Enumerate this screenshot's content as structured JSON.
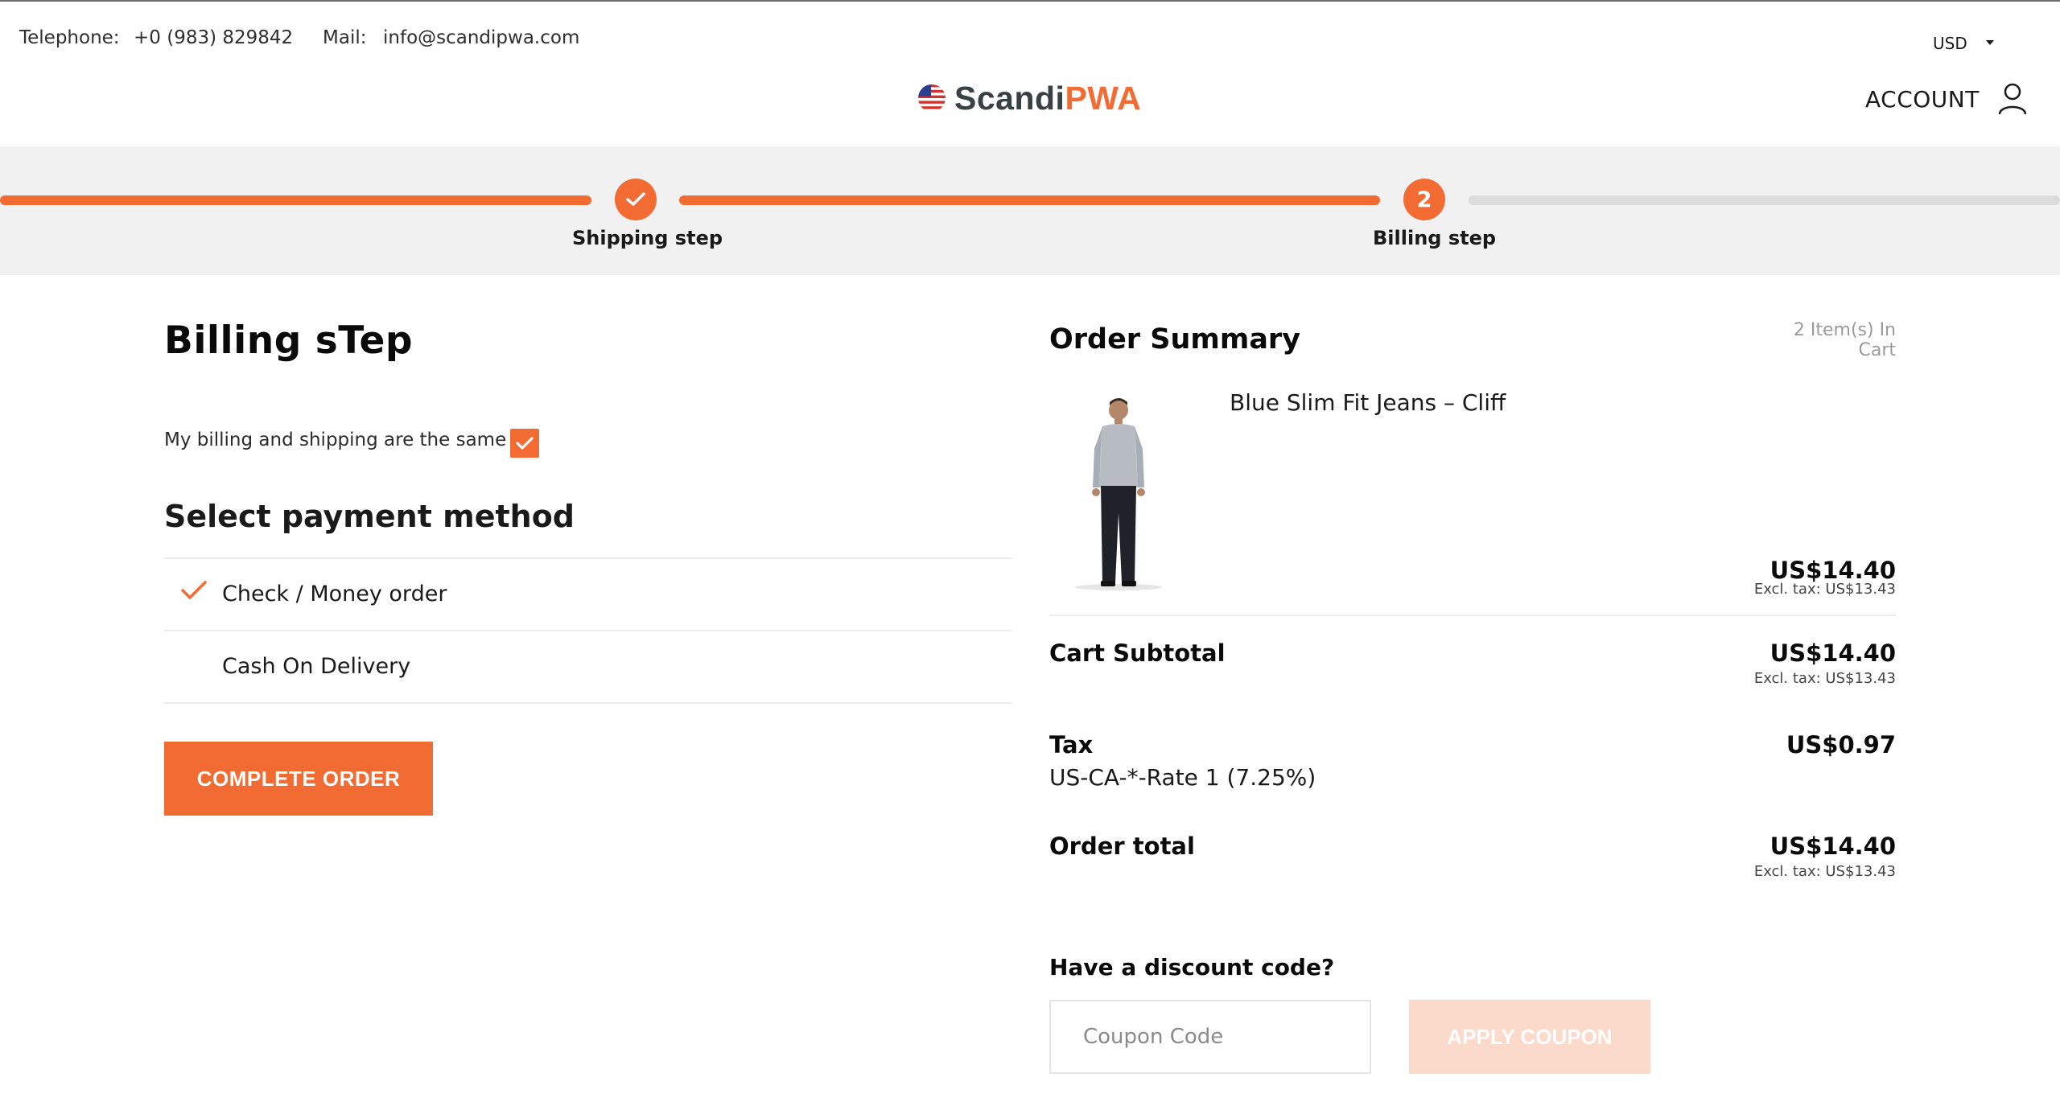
{
  "header": {
    "telephone_label": "Telephone:",
    "telephone_value": "+0 (983) 829842",
    "mail_label": "Mail:",
    "mail_value": "info@scandipwa.com",
    "currency": "USD",
    "logo_text_dark": "Scandi",
    "logo_text_accent": "PWA",
    "account_label": "ACCOUNT"
  },
  "progress": {
    "steps": [
      {
        "label": "Shipping step",
        "state": "done"
      },
      {
        "label": "Billing step",
        "state": "current",
        "number": "2"
      }
    ]
  },
  "billing": {
    "title": "Billing sTep",
    "same_address_label": "My billing and shipping are the same",
    "same_address_checked": true,
    "payment_title": "Select payment method",
    "methods": [
      {
        "label": "Check / Money order",
        "selected": true
      },
      {
        "label": "Cash On Delivery",
        "selected": false
      }
    ],
    "complete_button": "COMPLETE ORDER"
  },
  "summary": {
    "title": "Order Summary",
    "items_count": "2 Item(s) In Cart",
    "product": {
      "name": "Blue Slim Fit Jeans – Cliff",
      "price": "US$14.40",
      "price_excl": "Excl. tax: US$13.43"
    },
    "subtotal_label": "Cart Subtotal",
    "subtotal": "US$14.40",
    "subtotal_excl": "Excl. tax: US$13.43",
    "tax_label": "Tax",
    "tax_rate": "US-CA-*-Rate 1 (7.25%)",
    "tax": "US$0.97",
    "total_label": "Order total",
    "total": "US$14.40",
    "total_excl": "Excl. tax: US$13.43",
    "discount_label": "Have a discount code?",
    "coupon_placeholder": "Coupon Code",
    "apply_button": "APPLY COUPON"
  },
  "colors": {
    "accent": "#f26b33",
    "accent_light": "#fbd9cb",
    "progress_bg": "#f1f1f1",
    "progress_todo": "#dcdcdc"
  }
}
